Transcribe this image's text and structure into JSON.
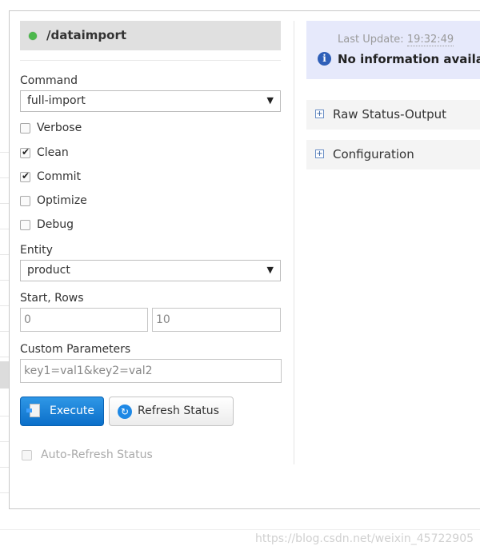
{
  "core": {
    "title": "/dataimport",
    "status_color": "#4cb84c"
  },
  "form": {
    "command_label": "Command",
    "command_value": "full-import",
    "options": [
      {
        "label": "Verbose",
        "checked": false
      },
      {
        "label": "Clean",
        "checked": true
      },
      {
        "label": "Commit",
        "checked": true
      },
      {
        "label": "Optimize",
        "checked": false
      },
      {
        "label": "Debug",
        "checked": false
      }
    ],
    "entity_label": "Entity",
    "entity_value": "product",
    "start_rows_label": "Start, Rows",
    "start_value": "0",
    "rows_value": "10",
    "custom_params_label": "Custom Parameters",
    "custom_params_value": "key1=val1&key2=val2",
    "execute_label": "Execute",
    "refresh_label": "Refresh Status",
    "auto_refresh_label": "Auto-Refresh Status",
    "auto_refresh_checked": false
  },
  "status": {
    "last_update_label": "Last Update:",
    "last_update_time": "19:32:49",
    "message": "No information availa"
  },
  "sections": [
    {
      "label": "Raw Status-Output"
    },
    {
      "label": "Configuration"
    }
  ],
  "watermark": "https://blog.csdn.net/weixin_45722905",
  "colors": {
    "execute_button": "#1a80d6",
    "info_box_bg": "#e6e9fb",
    "header_bg": "#e0e0e0"
  }
}
